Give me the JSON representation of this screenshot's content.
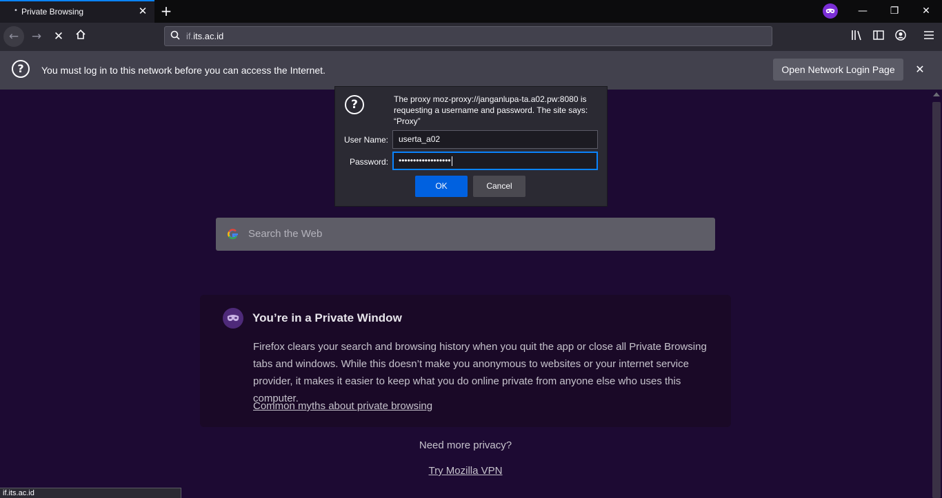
{
  "colors": {
    "accent": "#0a84ff",
    "private_purple": "#7b2ed6",
    "page_bg": "#1d0a33",
    "toolbar": "#2b2a33"
  },
  "tab": {
    "title": "Private Browsing",
    "icon": "private-dot-icon"
  },
  "url": {
    "prefix": "if.",
    "host": "its.ac.id"
  },
  "notification": {
    "message": "You must log in to this network before you can access the Internet.",
    "button_label": "Open Network Login Page"
  },
  "dialog": {
    "message": "The proxy moz-proxy://janganlupa-ta.a02.pw:8080 is requesting a username and password. The site says: “Proxy”",
    "username_label": "User Name:",
    "username_value": "userta_a02",
    "password_label": "Password:",
    "password_value": "••••••••••••••••••",
    "ok_label": "OK",
    "cancel_label": "Cancel"
  },
  "page": {
    "search_placeholder": "Search the Web",
    "private_title": "You’re in a Private Window",
    "private_text": "Firefox clears your search and browsing history when you quit the app or close all Private Browsing tabs and windows. While this doesn’t make you anonymous to websites or your internet service provider, it makes it easier to keep what you do online private from anyone else who uses this computer.",
    "private_link": "Common myths about private browsing",
    "more_privacy": "Need more privacy?",
    "vpn_link": "Try Mozilla VPN"
  },
  "status_text": "if.its.ac.id"
}
